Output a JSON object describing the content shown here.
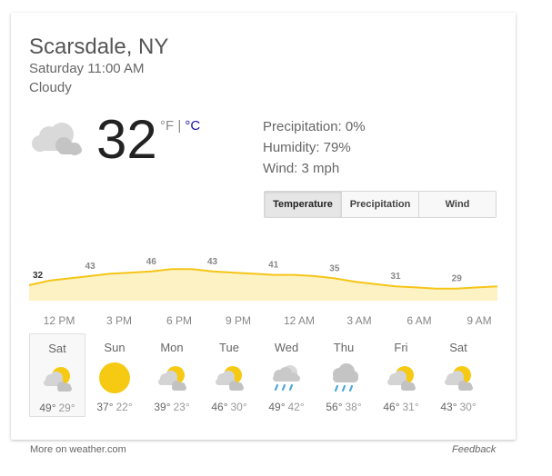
{
  "location": "Scarsdale, NY",
  "datetime": "Saturday 11:00 AM",
  "condition": "Cloudy",
  "current": {
    "temp": "32",
    "unit_f": "°F",
    "unit_sep": " | ",
    "unit_c": "°C",
    "icon": "cloudy-icon"
  },
  "details": {
    "precipitation": "Precipitation: 0%",
    "humidity": "Humidity: 79%",
    "wind": "Wind: 3 mph"
  },
  "tabs": [
    {
      "label": "Temperature",
      "active": true
    },
    {
      "label": "Precipitation",
      "active": false
    },
    {
      "label": "Wind",
      "active": false
    }
  ],
  "chart_data": {
    "type": "area",
    "series": [
      {
        "values": [
          32,
          36,
          38,
          40,
          42,
          43,
          44,
          46,
          46,
          44,
          43,
          42,
          41,
          41,
          40,
          38,
          35,
          33,
          31,
          30,
          29,
          29,
          30,
          31
        ]
      }
    ],
    "labels": [
      "32",
      "43",
      "46",
      "43",
      "41",
      "35",
      "31",
      "29"
    ],
    "ylim": [
      20,
      55
    ],
    "colors": {
      "line": "#f5c518",
      "fill": "#fdf2c4",
      "label": "#888888"
    }
  },
  "times": [
    "12 PM",
    "3 PM",
    "6 PM",
    "9 PM",
    "12 AM",
    "3 AM",
    "6 AM",
    "9 AM"
  ],
  "forecast": [
    {
      "day": "Sat",
      "hi": "49°",
      "lo": "29°",
      "icon": "partly-cloudy-icon",
      "selected": true
    },
    {
      "day": "Sun",
      "hi": "37°",
      "lo": "22°",
      "icon": "sunny-icon",
      "selected": false
    },
    {
      "day": "Mon",
      "hi": "39°",
      "lo": "23°",
      "icon": "partly-cloudy-icon",
      "selected": false
    },
    {
      "day": "Tue",
      "hi": "46°",
      "lo": "30°",
      "icon": "partly-cloudy-icon",
      "selected": false
    },
    {
      "day": "Wed",
      "hi": "49°",
      "lo": "42°",
      "icon": "rain-partly-cloudy-icon",
      "selected": false
    },
    {
      "day": "Thu",
      "hi": "56°",
      "lo": "38°",
      "icon": "rain-icon",
      "selected": false
    },
    {
      "day": "Fri",
      "hi": "46°",
      "lo": "31°",
      "icon": "partly-cloudy-icon",
      "selected": false
    },
    {
      "day": "Sat",
      "hi": "43°",
      "lo": "30°",
      "icon": "partly-cloudy-icon",
      "selected": false
    }
  ],
  "footer": {
    "source": "More on weather.com",
    "feedback": "Feedback"
  }
}
